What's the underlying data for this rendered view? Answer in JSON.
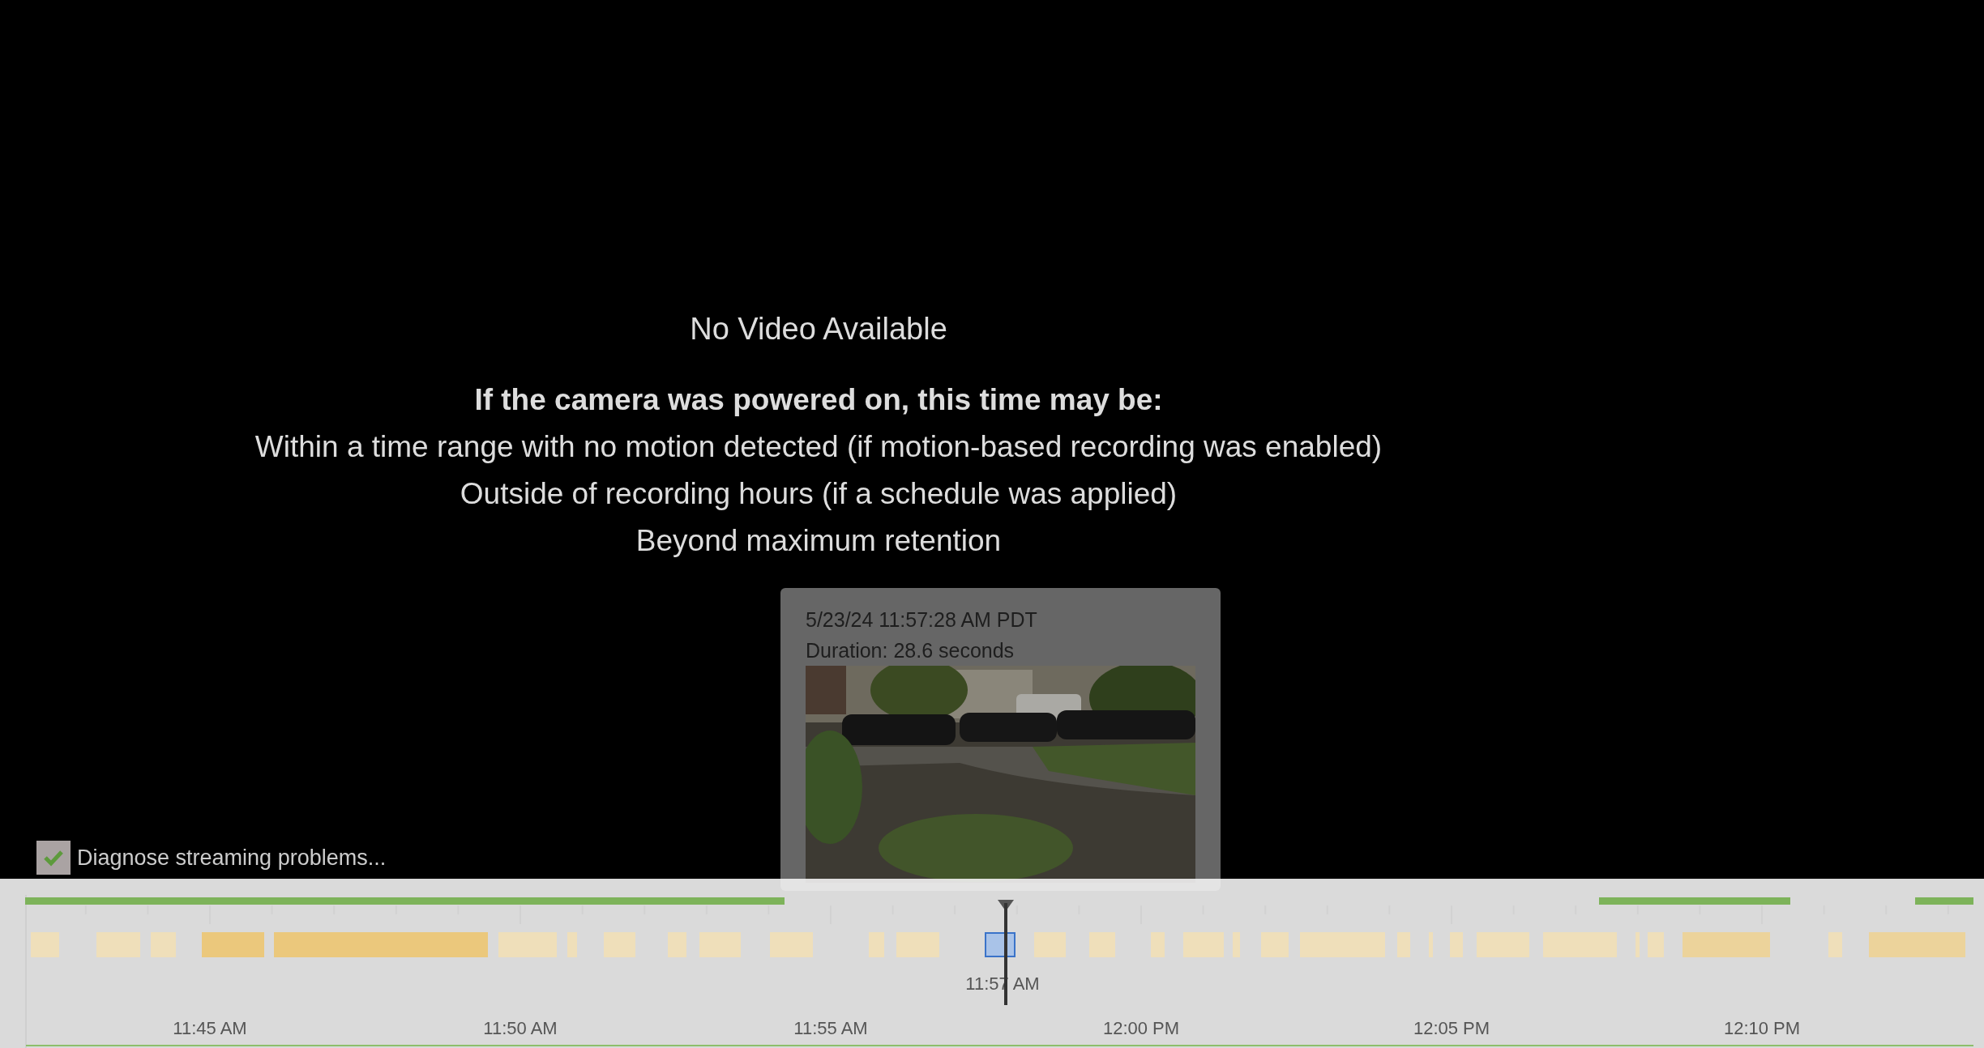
{
  "video": {
    "title": "No Video Available",
    "heading": "If the camera was powered on, this time may be:",
    "lines": [
      "Within a time range with no motion detected (if motion-based recording was enabled)",
      "Outside of recording hours (if a schedule was applied)",
      "Beyond maximum retention"
    ]
  },
  "diagnose": {
    "label": "Diagnose streaming problems...",
    "checked": true
  },
  "tooltip": {
    "timestamp": "5/23/24 11:57:28 AM PDT",
    "duration": "Duration: 28.6 seconds"
  },
  "timeline": {
    "cursor_label": "11:57 AM",
    "time_labels": [
      "11:45 AM",
      "11:50 AM",
      "11:55 AM",
      "12:00 PM",
      "12:05 PM",
      "12:10 PM"
    ]
  }
}
